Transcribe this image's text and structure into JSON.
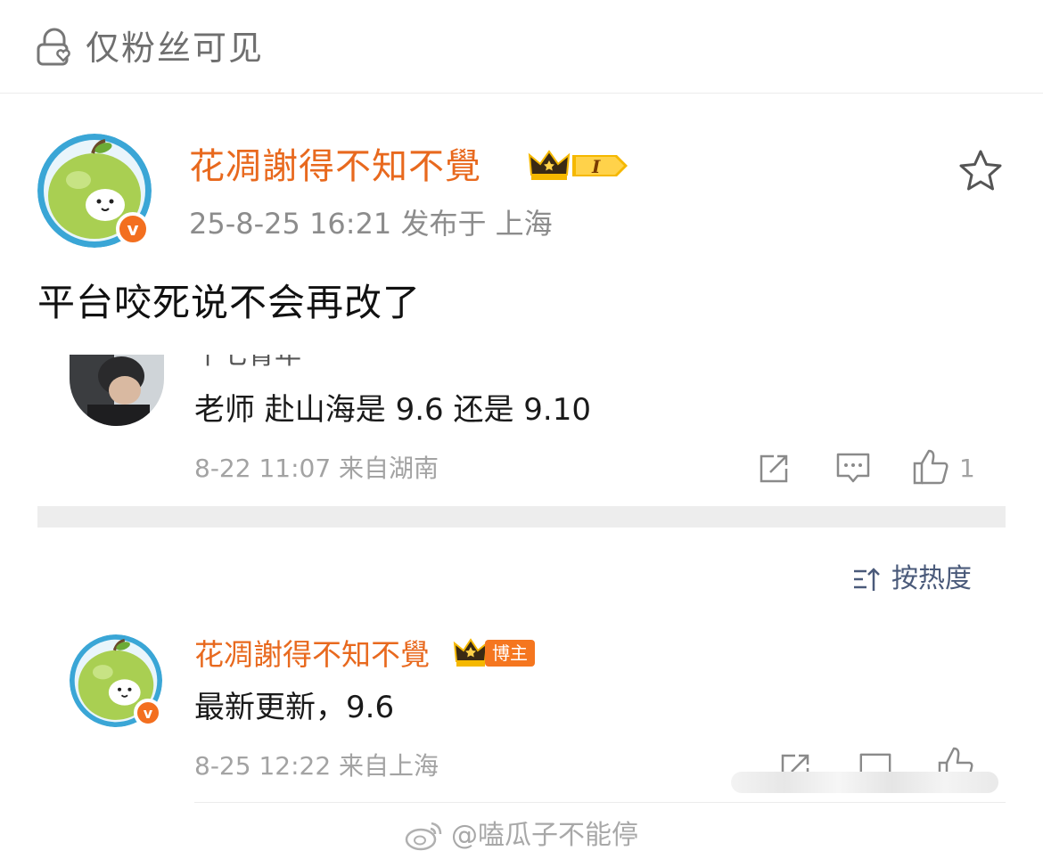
{
  "visibility": {
    "label": "仅粉丝可见"
  },
  "post": {
    "author": "花凋謝得不知不覺",
    "level_badge": "I",
    "meta": "25-8-25 16:21  发布于 上海",
    "body": "平台咬死说不会再改了"
  },
  "screenshot_comment": {
    "clipped_name": "十七青年",
    "text": "老师 赴山海是 9.6 还是 9.10",
    "meta": "8-22 11:07 来自湖南",
    "like_count": "1"
  },
  "sort": {
    "label": "按热度"
  },
  "reply": {
    "author": "花凋謝得不知不覺",
    "badge": "博主",
    "text": "最新更新，9.6",
    "meta": "8-25 12:22 来自上海"
  },
  "watermark": {
    "text": "@嗑瓜子不能停"
  },
  "colors": {
    "accent": "#e8691e",
    "verified": "#f36f1f",
    "crown_gold": "#f5b800"
  }
}
